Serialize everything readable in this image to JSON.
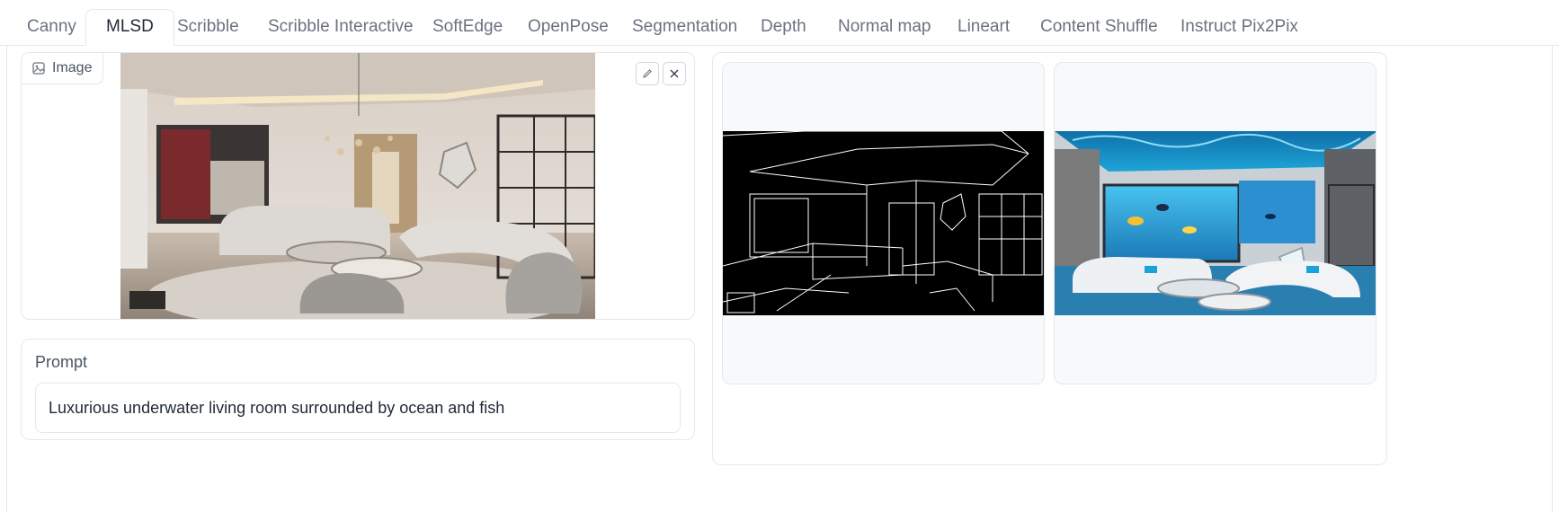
{
  "tabs": [
    {
      "label": "Canny",
      "active": false
    },
    {
      "label": "MLSD",
      "active": true
    },
    {
      "label": "Scribble",
      "active": false
    },
    {
      "label": "Scribble Interactive",
      "active": false
    },
    {
      "label": "SoftEdge",
      "active": false
    },
    {
      "label": "OpenPose",
      "active": false
    },
    {
      "label": "Segmentation",
      "active": false
    },
    {
      "label": "Depth",
      "active": false
    },
    {
      "label": "Normal map",
      "active": false
    },
    {
      "label": "Lineart",
      "active": false
    },
    {
      "label": "Content Shuffle",
      "active": false
    },
    {
      "label": "Instruct Pix2Pix",
      "active": false
    }
  ],
  "input_image": {
    "label": "Image",
    "icon": "image-icon",
    "edit_icon": "pencil-icon",
    "close_icon": "close-icon"
  },
  "prompt": {
    "label": "Prompt",
    "value": "Luxurious underwater living room surrounded by ocean and fish"
  },
  "colors": {
    "border": "#e5e7eb",
    "gallery_bg": "#f8f9fb",
    "text_muted": "#6b7280",
    "text": "#1f2937"
  }
}
